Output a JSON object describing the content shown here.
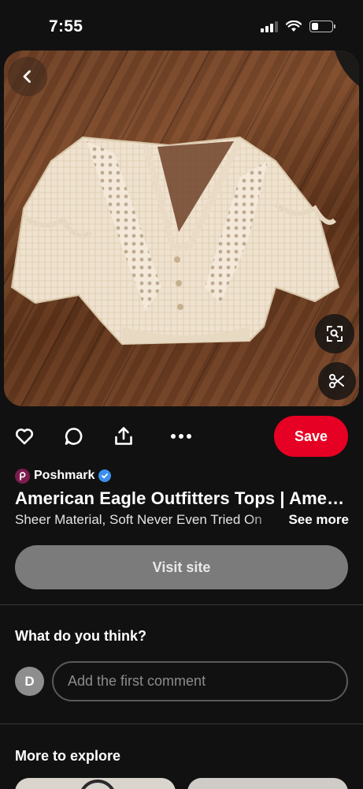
{
  "status_bar": {
    "time": "7:55",
    "battery_level": 0.35,
    "signal_bars_active": 3,
    "signal_bars_total": 4
  },
  "pin": {
    "image_icons": [
      "back-icon",
      "visual-search-icon",
      "scissors-icon"
    ],
    "actions": [
      "heart-icon",
      "comment-icon",
      "share-icon",
      "more-icon"
    ],
    "save_label": "Save",
    "source_name": "Poshmark",
    "source_verified": true,
    "title": "American Eagle Outfitters Tops | American Eagle Outfitters Crop Top",
    "description": "Sheer Material, Soft Never Even Tried On",
    "see_more_label": "See more",
    "visit_site_label": "Visit site"
  },
  "comments": {
    "heading": "What do you think?",
    "avatar_initial": "D",
    "input_placeholder": "Add the first comment"
  },
  "explore": {
    "heading": "More to explore"
  },
  "colors": {
    "background": "#111111",
    "save_red": "#e60023",
    "visit_site_gray": "#7b7b7b",
    "verified_blue": "#3b8ff0",
    "poshmark_maroon": "#7a1d4e"
  }
}
